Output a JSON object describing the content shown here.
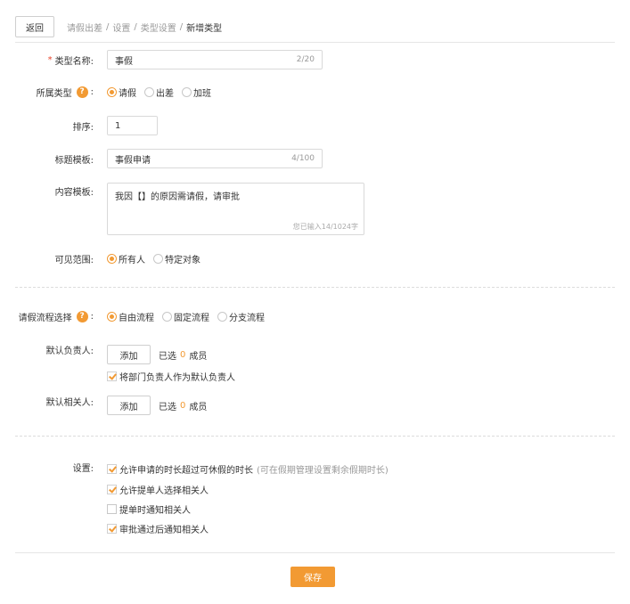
{
  "header": {
    "back_label": "返回",
    "breadcrumb": [
      "请假出差",
      "设置",
      "类型设置",
      "新增类型"
    ],
    "separator": "/"
  },
  "form": {
    "type_name": {
      "label": "类型名称:",
      "required_mark": "*",
      "value": "事假",
      "count": "2/20"
    },
    "category": {
      "label": "所属类型",
      "help": "?",
      "colon": ":",
      "options": [
        "请假",
        "出差",
        "加班"
      ],
      "selected": "请假"
    },
    "sort": {
      "label": "排序:",
      "value": "1"
    },
    "title_template": {
      "label": "标题模板:",
      "value": "事假申请",
      "count": "4/100"
    },
    "content_template": {
      "label": "内容模板:",
      "value": "我因【】的原因需请假，请审批",
      "count": "您已输入14/1024字"
    },
    "visibility": {
      "label": "可见范围:",
      "options": [
        "所有人",
        "特定对象"
      ],
      "selected": "所有人"
    }
  },
  "flow": {
    "choice": {
      "label": "请假流程选择",
      "help": "?",
      "colon": ":",
      "options": [
        "自由流程",
        "固定流程",
        "分支流程"
      ],
      "selected": "自由流程"
    },
    "default_owner": {
      "label": "默认负责人:",
      "add_label": "添加",
      "picked_prefix": "已选",
      "picked_count": "0",
      "picked_suffix": "成员",
      "dept_head_check": "将部门负责人作为默认负责人",
      "dept_head_checked": true
    },
    "default_related": {
      "label": "默认相关人:",
      "add_label": "添加",
      "picked_prefix": "已选",
      "picked_count": "0",
      "picked_suffix": "成员"
    }
  },
  "settings": {
    "label": "设置:",
    "options": [
      {
        "text": "允许申请的时长超过可休假的时长",
        "hint": "(可在假期管理设置剩余假期时长)",
        "checked": true
      },
      {
        "text": "允许提单人选择相关人",
        "hint": "",
        "checked": true
      },
      {
        "text": "提单时通知相关人",
        "hint": "",
        "checked": false
      },
      {
        "text": "审批通过后通知相关人",
        "hint": "",
        "checked": true
      }
    ]
  },
  "footer": {
    "save_label": "保存"
  },
  "colors": {
    "accent": "#f29a33",
    "required": "#e8452c",
    "border": "#d9d9d9",
    "muted": "#999999"
  }
}
